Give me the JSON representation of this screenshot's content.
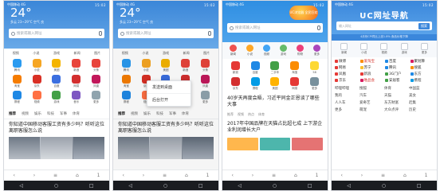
{
  "status": {
    "left": "中国移动 4G",
    "right": "15:02"
  },
  "p1": {
    "temp": "24°",
    "weather": "多云 23~29°C\n空气 良",
    "search_placeholder": "搜索或输入网址",
    "nav": [
      "视频",
      "小说",
      "游戏",
      "新闻",
      "图片"
    ],
    "apps": [
      {
        "label": "腾讯",
        "color": "#2b9bf0"
      },
      {
        "label": "小说",
        "color": "#f6a623"
      },
      {
        "label": "美团",
        "color": "#f4b400"
      },
      {
        "label": "新浪",
        "color": "#e8443b"
      },
      {
        "label": "头条",
        "color": "#e8443b"
      },
      {
        "label": "淘宝",
        "color": "#f57c00"
      },
      {
        "label": "京东",
        "color": "#d93025"
      },
      {
        "label": "百度",
        "color": "#3b6fe0"
      },
      {
        "label": "网易",
        "color": "#d32f2f"
      },
      {
        "label": "凤凰",
        "color": "#c2185b"
      },
      {
        "label": "携程",
        "color": "#1e88e5"
      },
      {
        "label": "视频",
        "color": "#ff7043"
      },
      {
        "label": "游戏",
        "color": "#43a047"
      },
      {
        "label": "音乐",
        "color": "#7e57c2"
      },
      {
        "label": "更多",
        "color": "#90a4ae"
      }
    ],
    "tabs": [
      "推荐",
      "视频",
      "娱乐",
      "科技",
      "军事",
      "体育"
    ],
    "headline": "你知道中国移动客服工资有多少吗？听听这位离职客服怎么说"
  },
  "p2": {
    "menu": [
      "发送到桌面",
      "后台打开"
    ]
  },
  "p3": {
    "brand": "UC浏览器\n全民狂欢",
    "search_placeholder": "搜索或输入网址",
    "icons": [
      {
        "label": "新闻",
        "color": "#ef5350"
      },
      {
        "label": "小说",
        "color": "#ffa726"
      },
      {
        "label": "视频",
        "color": "#42a5f5"
      },
      {
        "label": "游戏",
        "color": "#66bb6a"
      },
      {
        "label": "购物",
        "color": "#ec407a"
      },
      {
        "label": "更多",
        "color": "#ab47bc"
      }
    ],
    "apps": [
      {
        "label": "新浪",
        "color": "#e53935"
      },
      {
        "label": "百度",
        "color": "#1e88e5"
      },
      {
        "label": "二手车",
        "color": "#43a047"
      },
      {
        "label": "淘宝",
        "color": "#fb8c00"
      },
      {
        "label": "58",
        "color": "#fdd835"
      },
      {
        "label": "京东",
        "color": "#d32f2f"
      },
      {
        "label": "携程",
        "color": "#039be5"
      },
      {
        "label": "美团",
        "color": "#ffb300"
      },
      {
        "label": "网易",
        "color": "#e53935"
      },
      {
        "label": "更多",
        "color": "#78909c"
      }
    ],
    "headline": "40岁天再度会晤，习近平同金正恩谈了哪些大事",
    "tabs": [
      "推荐",
      "视频",
      "热点",
      "体育"
    ],
    "headline2": "2017年中国品牌在天猫占比超七成 上下游企业利润增长大户"
  },
  "p4": {
    "title": "UC网址导航",
    "search_placeholder": "输入网址",
    "search_button": "搜索",
    "note": "4月份CPI同比上涨1.8% 食品价格下降",
    "cats": [
      "新闻",
      "小说",
      "视频",
      "游戏",
      "更多"
    ],
    "list": [
      {
        "label": "微博",
        "color": "#e53935"
      },
      {
        "label": "爱淘宝",
        "color": "#fb8c00",
        "red": true
      },
      {
        "label": "百度",
        "color": "#1e88e5"
      },
      {
        "label": "聚划算",
        "color": "#d81b60"
      },
      {
        "label": "网易",
        "color": "#e53935"
      },
      {
        "label": "苏宁",
        "color": "#fbc02d"
      },
      {
        "label": "腾讯",
        "color": "#1e88e5"
      },
      {
        "label": "搜狐",
        "color": "#fb8c00"
      },
      {
        "label": "凤凰",
        "color": "#e53935"
      },
      {
        "label": "新浪",
        "color": "#e53935"
      },
      {
        "label": "3G门户",
        "color": "#43a047"
      },
      {
        "label": "东方",
        "color": "#1e88e5"
      },
      {
        "label": "京东",
        "color": "#e53935"
      },
      {
        "label": "唯品会",
        "color": "#d81b60",
        "red": true
      },
      {
        "label": "安居客",
        "color": "#43a047"
      },
      {
        "label": "携程",
        "color": "#039be5"
      }
    ],
    "links": [
      "哔哩哔哩",
      "搜狐",
      "体育",
      "中国蓝",
      "我的",
      "汽车",
      "天猫",
      "美女",
      "人人车",
      "爱奇艺",
      "东方财富",
      "赶集",
      "更多",
      "萌宠",
      "大众点评",
      "历史"
    ]
  },
  "bottom": [
    "‹",
    "›",
    "≡",
    "⌂",
    "1"
  ],
  "navbar": [
    "◁",
    "○",
    "□"
  ]
}
